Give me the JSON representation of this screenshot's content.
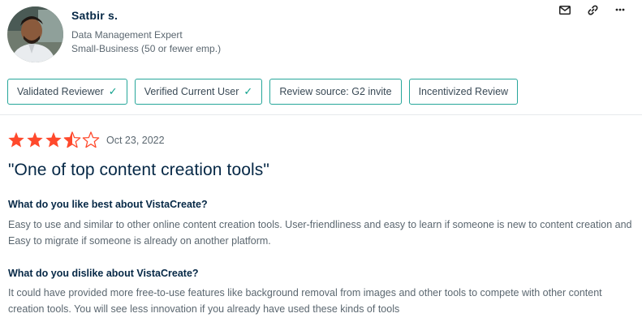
{
  "reviewer": {
    "name": "Satbir s.",
    "title": "Data Management Expert",
    "company_size": "Small-Business (50 or fewer emp.)"
  },
  "actions": {
    "icons": [
      "mail-icon",
      "link-icon",
      "more-icon"
    ]
  },
  "badges": [
    {
      "label": "Validated Reviewer",
      "checked": true
    },
    {
      "label": "Verified Current User",
      "checked": true
    },
    {
      "label": "Review source: G2 invite",
      "checked": false
    },
    {
      "label": "Incentivized Review",
      "checked": false
    }
  ],
  "review": {
    "rating": 3.5,
    "max_rating": 5,
    "date": "Oct 23, 2022",
    "title": "\"One of top content creation tools\"",
    "questions": [
      {
        "question": "What do you like best about VistaCreate?",
        "answer": "Easy to use and similar to other online content creation tools. User-friendliness and easy to learn if someone is new to content creation and Easy to migrate if someone is already on another platform."
      },
      {
        "question": "What do you dislike about VistaCreate?",
        "answer": "It could have provided more free-to-use features like background removal from images and other tools to compete with other content creation tools. You will see less innovation if you already have used these kinds of tools"
      }
    ]
  },
  "colors": {
    "star": "#ff492c",
    "badge_border": "#26a69a",
    "check": "#12a18d",
    "heading": "#062846",
    "body_text": "#5b6770"
  }
}
